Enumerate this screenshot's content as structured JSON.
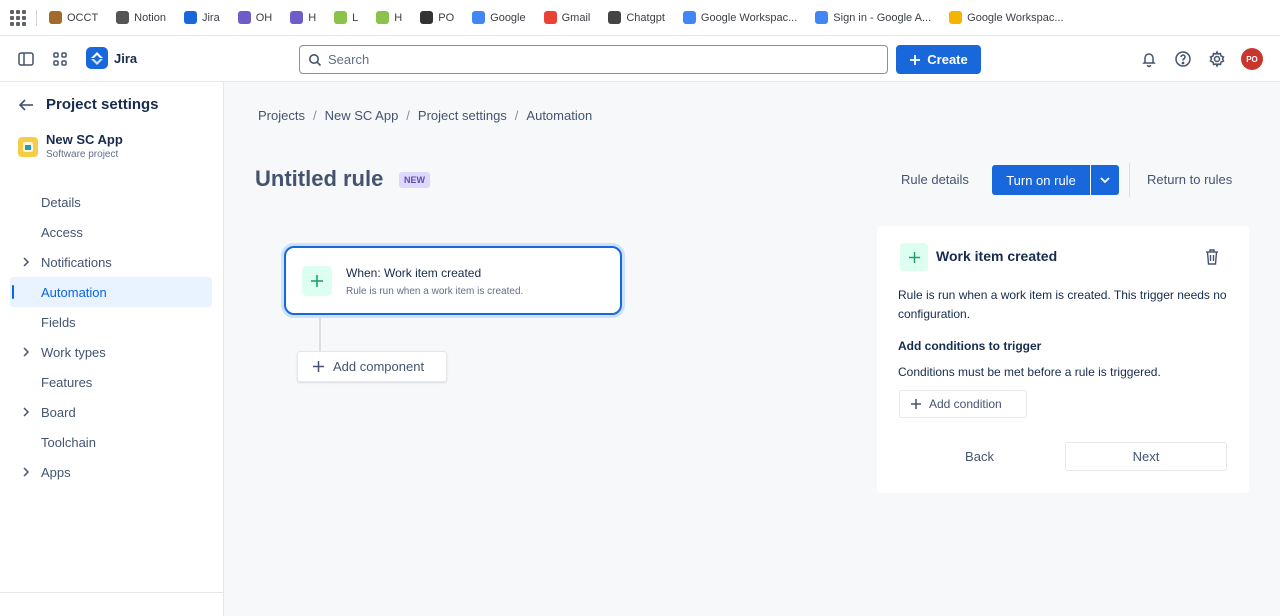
{
  "bookmarks": [
    {
      "label": "OCCT",
      "icon": "box-icon",
      "color": "#a36b2b"
    },
    {
      "label": "Notion",
      "icon": "home-icon",
      "color": "#555555"
    },
    {
      "label": "Jira",
      "icon": "jira-icon",
      "color": "#1868db"
    },
    {
      "label": "OH",
      "icon": "oh-icon",
      "color": "#6e5dc6"
    },
    {
      "label": "H",
      "icon": "letter-s-icon",
      "color": "#6e5dc6"
    },
    {
      "label": "L",
      "icon": "leaf-icon",
      "color": "#8bc34a"
    },
    {
      "label": "H",
      "icon": "leaf-icon",
      "color": "#8bc34a"
    },
    {
      "label": "PO",
      "icon": "globe-icon",
      "color": "#333333"
    },
    {
      "label": "Google",
      "icon": "google-icon",
      "color": "#4285f4"
    },
    {
      "label": "Gmail",
      "icon": "gmail-icon",
      "color": "#ea4335"
    },
    {
      "label": "Chatgpt",
      "icon": "chatgpt-icon",
      "color": "#444444"
    },
    {
      "label": "Google Workspac...",
      "icon": "google-icon",
      "color": "#4285f4"
    },
    {
      "label": "Sign in - Google A...",
      "icon": "google-icon",
      "color": "#4285f4"
    },
    {
      "label": "Google Workspac...",
      "icon": "folder-icon",
      "color": "#f4b400"
    }
  ],
  "topnav": {
    "logo": "Jira",
    "search_placeholder": "Search",
    "create_label": "Create",
    "avatar_initials": "PO"
  },
  "sidebar": {
    "back_label": "Project settings",
    "project_name": "New SC App",
    "project_type": "Software project",
    "items": [
      {
        "label": "Details"
      },
      {
        "label": "Access"
      },
      {
        "label": "Notifications"
      },
      {
        "label": "Automation"
      },
      {
        "label": "Fields"
      },
      {
        "label": "Work types"
      },
      {
        "label": "Features"
      },
      {
        "label": "Board"
      },
      {
        "label": "Toolchain"
      },
      {
        "label": "Apps"
      }
    ]
  },
  "breadcrumb": [
    "Projects",
    "New SC App",
    "Project settings",
    "Automation"
  ],
  "rule": {
    "title": "Untitled rule",
    "badge": "NEW",
    "rule_details": "Rule details",
    "turn_on": "Turn on rule",
    "return": "Return to rules"
  },
  "trigger": {
    "title": "When: Work item created",
    "subtitle": "Rule is run when a work item is created."
  },
  "add_component": "Add component",
  "panel": {
    "title": "Work item created",
    "description": "Rule is run when a work item is created. This trigger needs no configuration.",
    "conditions_heading": "Add conditions to trigger",
    "conditions_desc": "Conditions must be met before a rule is triggered.",
    "add_condition": "Add condition",
    "back": "Back",
    "next": "Next"
  },
  "colors": {
    "brand": "#1868db",
    "trigger_bg": "#dcfff1",
    "badge_bg": "#dfd8fd",
    "active_bg": "#e9f2ff"
  }
}
